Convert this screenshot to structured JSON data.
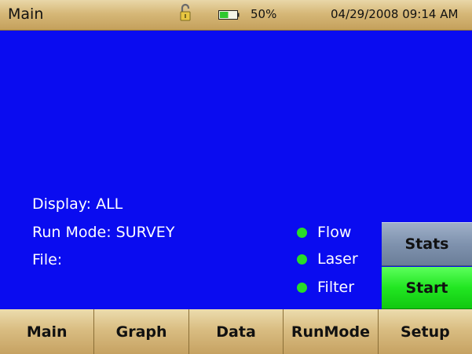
{
  "statusbar": {
    "title": "Main",
    "battery_percent": "50%",
    "datetime": "04/29/2008 09:14 AM",
    "battery_level": 0.5,
    "lock_icon": "unlocked-padlock"
  },
  "info": {
    "display": "Display: ALL",
    "run_mode": "Run Mode: SURVEY",
    "file": "File:"
  },
  "indicators": [
    {
      "label": "Flow",
      "color": "#28dc28"
    },
    {
      "label": "Laser",
      "color": "#28dc28"
    },
    {
      "label": "Filter",
      "color": "#28dc28"
    }
  ],
  "side_buttons": {
    "stats": "Stats",
    "start": "Start"
  },
  "tabs": [
    {
      "label": "Main"
    },
    {
      "label": "Graph"
    },
    {
      "label": "Data"
    },
    {
      "label": "RunMode"
    },
    {
      "label": "Setup"
    }
  ],
  "colors": {
    "screen_background": "#0a0cf0",
    "start_button": "#22e622",
    "stats_button": "#7f92ae"
  }
}
